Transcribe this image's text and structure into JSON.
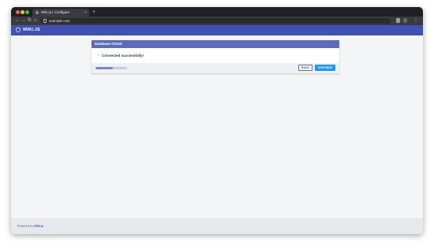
{
  "browser": {
    "tab_title": "Wiki.js | Configure",
    "tab_close": "×",
    "new_tab": "+",
    "url": "example.com",
    "back_icon": "←",
    "forward_icon": "→",
    "reload_icon": "↻",
    "home_icon": "⌂",
    "menu_icon": "⋮"
  },
  "app": {
    "logo_text": "WIKI.JS"
  },
  "card": {
    "title": "Database Check",
    "check_icon": "✓",
    "status": "Connected successfully!",
    "progress": 0.55,
    "back_label": "BACK",
    "continue_label": "CONTINUE"
  },
  "footer": {
    "prefix": "Powered by",
    "link": "Wiki.js"
  },
  "colors": {
    "primary": "#3f51b5",
    "card_header": "#5c6bc0",
    "accent": "#2196f3",
    "success": "#4caf50"
  }
}
